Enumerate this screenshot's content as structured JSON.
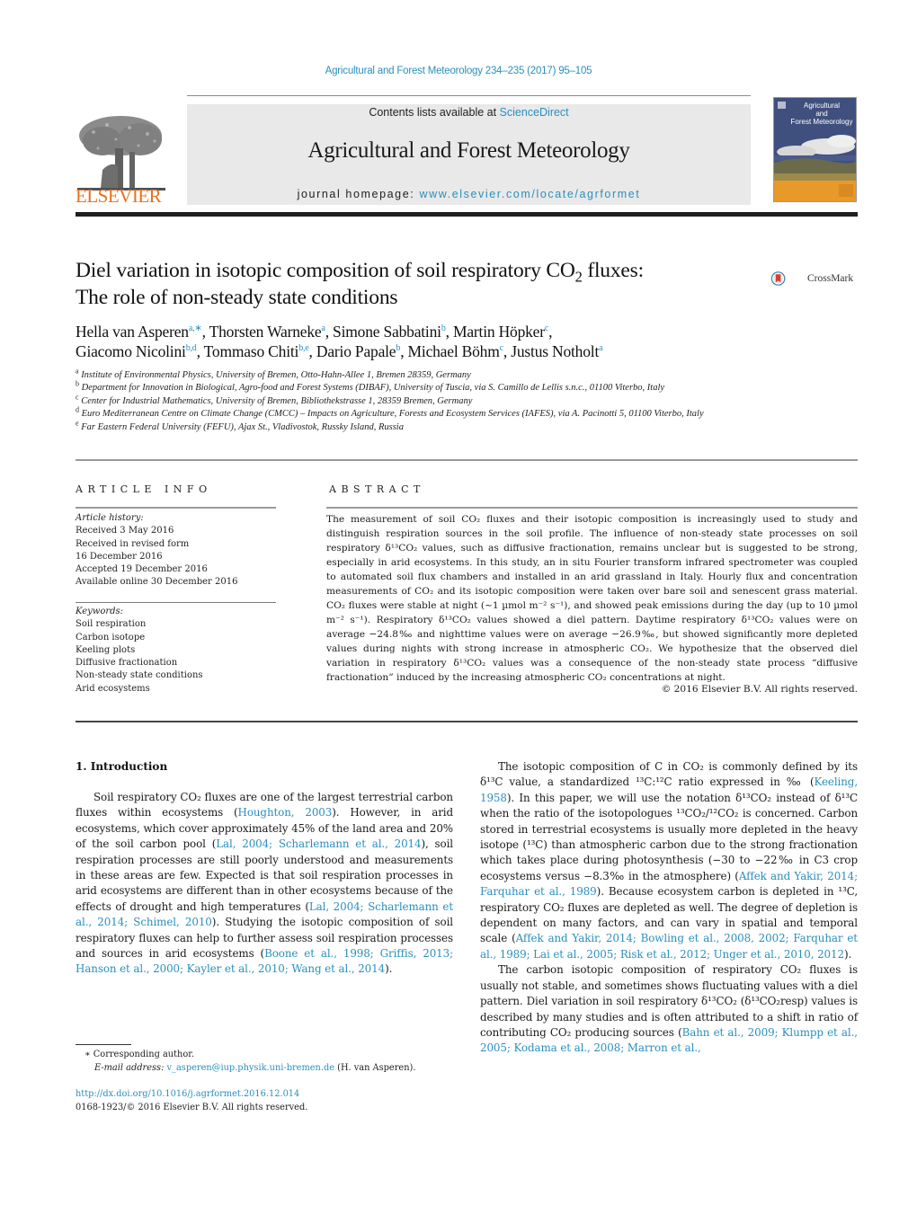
{
  "running_header": "Agricultural and Forest Meteorology 234–235 (2017) 95–105",
  "masthead": {
    "publisher_logo_text": "ELSEVIER",
    "contents_prefix": "Contents lists available at ",
    "contents_link": "ScienceDirect",
    "journal_title": "Agricultural and Forest Meteorology",
    "homepage_prefix": "journal homepage: ",
    "homepage_link": "www.elsevier.com/locate/agrformet",
    "cover_title_line1": "Agricultural",
    "cover_title_line2": "and",
    "cover_title_line3": "Forest Meteorology"
  },
  "crossmark_label": "CrossMark",
  "article": {
    "title_part1": "Diel variation in isotopic composition of soil respiratory CO",
    "title_sub": "2",
    "title_part2": " fluxes:",
    "title_line2": "The role of non-steady state conditions",
    "authors": [
      {
        "name": "Hella van Asperen",
        "aff": "a,∗",
        "sep": ", "
      },
      {
        "name": "Thorsten Warneke",
        "aff": "a",
        "sep": ", "
      },
      {
        "name": "Simone Sabbatini",
        "aff": "b",
        "sep": ", "
      },
      {
        "name": "Martin Höpker",
        "aff": "c",
        "sep": ","
      },
      {
        "name": "Giacomo Nicolini",
        "aff": "b,d",
        "sep": ", "
      },
      {
        "name": "Tommaso Chiti",
        "aff": "b,e",
        "sep": ", "
      },
      {
        "name": "Dario Papale",
        "aff": "b",
        "sep": ", "
      },
      {
        "name": "Michael Böhm",
        "aff": "c",
        "sep": ", "
      },
      {
        "name": "Justus Notholt",
        "aff": "a",
        "sep": ""
      }
    ],
    "affiliations": [
      {
        "key": "a",
        "text": "Institute of Environmental Physics, University of Bremen, Otto-Hahn-Allee 1, Bremen 28359, Germany"
      },
      {
        "key": "b",
        "text": "Department for Innovation in Biological, Agro-food and Forest Systems (DIBAF), University of Tuscia, via S. Camillo de Lellis s.n.c., 01100 Viterbo, Italy"
      },
      {
        "key": "c",
        "text": "Center for Industrial Mathematics, University of Bremen, Bibliothekstrasse 1, 28359 Bremen, Germany"
      },
      {
        "key": "d",
        "text": "Euro Mediterranean Centre on Climate Change (CMCC) – Impacts on Agriculture, Forests and Ecosystem Services (IAFES), via A. Pacinotti 5, 01100 Viterbo, Italy"
      },
      {
        "key": "e",
        "text": "Far Eastern Federal University (FEFU), Ajax St., Vladivostok, Russky Island, Russia"
      }
    ]
  },
  "article_info": {
    "heading": "ARTICLE INFO",
    "history_label": "Article history:",
    "history": [
      "Received 3 May 2016",
      "Received in revised form",
      "16 December 2016",
      "Accepted 19 December 2016",
      "Available online 30 December 2016"
    ],
    "keywords_label": "Keywords:",
    "keywords": [
      "Soil respiration",
      "Carbon isotope",
      "Keeling plots",
      "Diffusive fractionation",
      "Non-steady state conditions",
      "Arid ecosystems"
    ]
  },
  "abstract": {
    "heading": "ABSTRACT",
    "text": "The measurement of soil CO₂ fluxes and their isotopic composition is increasingly used to study and distinguish respiration sources in the soil profile. The influence of non-steady state processes on soil respiratory δ¹³CO₂ values, such as diffusive fractionation, remains unclear but is suggested to be strong, especially in arid ecosystems. In this study, an in situ Fourier transform infrared spectrometer was coupled to automated soil flux chambers and installed in an arid grassland in Italy. Hourly flux and concentration measurements of CO₂ and its isotopic composition were taken over bare soil and senescent grass material. CO₂ fluxes were stable at night (~1 µmol m⁻² s⁻¹), and showed peak emissions during the day (up to 10 µmol m⁻² s⁻¹). Respiratory δ¹³CO₂ values showed a diel pattern. Daytime respiratory δ¹³CO₂ values were on average −24.8‰ and nighttime values were on average −26.9‰, but showed significantly more depleted values during nights with strong increase in atmospheric CO₂. We hypothesize that the observed diel variation in respiratory δ¹³CO₂ values was a consequence of the non-steady state process “diffusive fractionation” induced by the increasing atmospheric CO₂ concentrations at night.",
    "copyright": "© 2016 Elsevier B.V. All rights reserved."
  },
  "body": {
    "section_heading": "1.  Introduction",
    "left_col": [
      {
        "t": "Soil respiratory CO₂ fluxes are one of the largest terrestrial carbon fluxes within ecosystems ("
      },
      {
        "link": "Houghton, 2003"
      },
      {
        "t": "). However, in arid ecosystems, which cover approximately 45% of the land area and 20% of the soil carbon pool ("
      },
      {
        "link": "Lal, 2004; Scharlemann et al., 2014"
      },
      {
        "t": "), soil respiration processes are still poorly understood and measurements in these areas are few. Expected is that soil respiration processes in arid ecosystems are different than in other ecosystems because of the effects of drought and high temperatures ("
      },
      {
        "link": "Lal, 2004; Scharlemann et al., 2014; Schimel, 2010"
      },
      {
        "t": "). Studying the isotopic composition of soil respiratory fluxes can help to further assess soil respiration processes and sources in arid ecosystems ("
      },
      {
        "link": "Boone et al., 1998; Griffis, 2013; Hanson et al., 2000; Kayler et al., 2010; Wang et al., 2014"
      },
      {
        "t": ")."
      }
    ],
    "right_col_p1": [
      {
        "t": "The isotopic composition of C in CO₂ is commonly defined by its δ¹³C value, a standardized ¹³C:¹²C ratio expressed in ‰ ("
      },
      {
        "link": "Keeling, 1958"
      },
      {
        "t": "). In this paper, we will use the notation δ¹³CO₂ instead of δ¹³C when the ratio of the isotopologues ¹³CO₂/¹²CO₂ is concerned. Carbon stored in terrestrial ecosystems is usually more depleted in the heavy isotope (¹³C) than atmospheric carbon due to the strong fractionation which takes place during photosynthesis (−30 to −22‰ in C3 crop ecosystems versus −8.3‰ in the atmosphere) ("
      },
      {
        "link": "Affek and Yakir, 2014; Farquhar et al., 1989"
      },
      {
        "t": "). Because ecosystem carbon is depleted in ¹³C, respiratory CO₂ fluxes are depleted as well. The degree of depletion is dependent on many factors, and can vary in spatial and temporal scale ("
      },
      {
        "link": "Affek and Yakir, 2014; Bowling et al., 2008, 2002; Farquhar et al., 1989; Lai et al., 2005; Risk et al., 2012; Unger et al., 2010, 2012"
      },
      {
        "t": ")."
      }
    ],
    "right_col_p2": [
      {
        "t": "The carbon isotopic composition of respiratory CO₂ fluxes is usually not stable, and sometimes shows fluctuating values with a diel pattern. Diel variation in soil respiratory δ¹³CO₂ (δ¹³CO₂resp) values is described by many studies and is often attributed to a shift in ratio of contributing CO₂ producing sources ("
      },
      {
        "link": "Bahn et al., 2009; Klumpp et al., 2005; Kodama et al., 2008; Marron et al.,"
      }
    ]
  },
  "footnote": {
    "marker": "∗",
    "corresponding": "Corresponding author.",
    "email_label": "E-mail address:",
    "email": "v_asperen@iup.physik.uni-bremen.de",
    "email_suffix": " (H. van Asperen)."
  },
  "doi": {
    "link": "http://dx.doi.org/10.1016/j.agrformet.2016.12.014",
    "issn_line": "0168-1923/© 2016 Elsevier B.V. All rights reserved."
  },
  "colors": {
    "link": "#2a8fbd",
    "elsevier_orange": "#e8711b",
    "banner_bg": "#e9e9e9",
    "crossmark_red": "#d8412f"
  }
}
